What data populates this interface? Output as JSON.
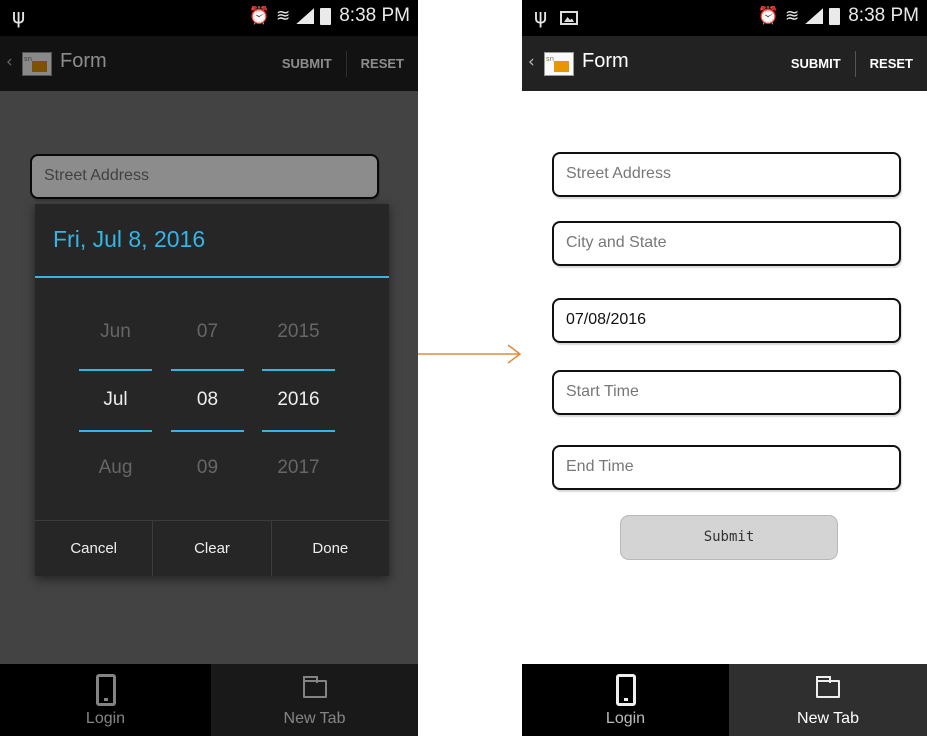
{
  "status_bar": {
    "time": "8:38 PM",
    "usb_icon": "usb-icon",
    "alarm_icon": "alarm-clock-icon",
    "wifi_icon": "wifi-icon",
    "signal_icon": "cell-signal-icon",
    "battery_icon": "battery-icon",
    "image_icon": "image-notification-icon"
  },
  "action_bar": {
    "logo_text": "sn",
    "title": "Form",
    "submit_label": "SUBMIT",
    "reset_label": "RESET"
  },
  "form": {
    "street_placeholder": "Street Address",
    "city_placeholder": "City and State",
    "date_value": "07/08/2016",
    "start_placeholder": "Start Time",
    "end_placeholder": "End Time",
    "submit_label": "Submit"
  },
  "date_picker": {
    "header": "Fri, Jul 8, 2016",
    "months": [
      "Jun",
      "Jul",
      "Aug"
    ],
    "days": [
      "07",
      "08",
      "09"
    ],
    "years": [
      "2015",
      "2016",
      "2017"
    ],
    "cancel_label": "Cancel",
    "clear_label": "Clear",
    "done_label": "Done"
  },
  "tabs": [
    {
      "label": "Login",
      "icon": "phone-icon"
    },
    {
      "label": "New Tab",
      "icon": "folder-icon"
    }
  ],
  "colors": {
    "accent": "#33b5e5",
    "arrow": "#e8883a",
    "action_bar": "#222222",
    "tab_active": "#000000",
    "tab_inactive": "#2f2f2f"
  }
}
